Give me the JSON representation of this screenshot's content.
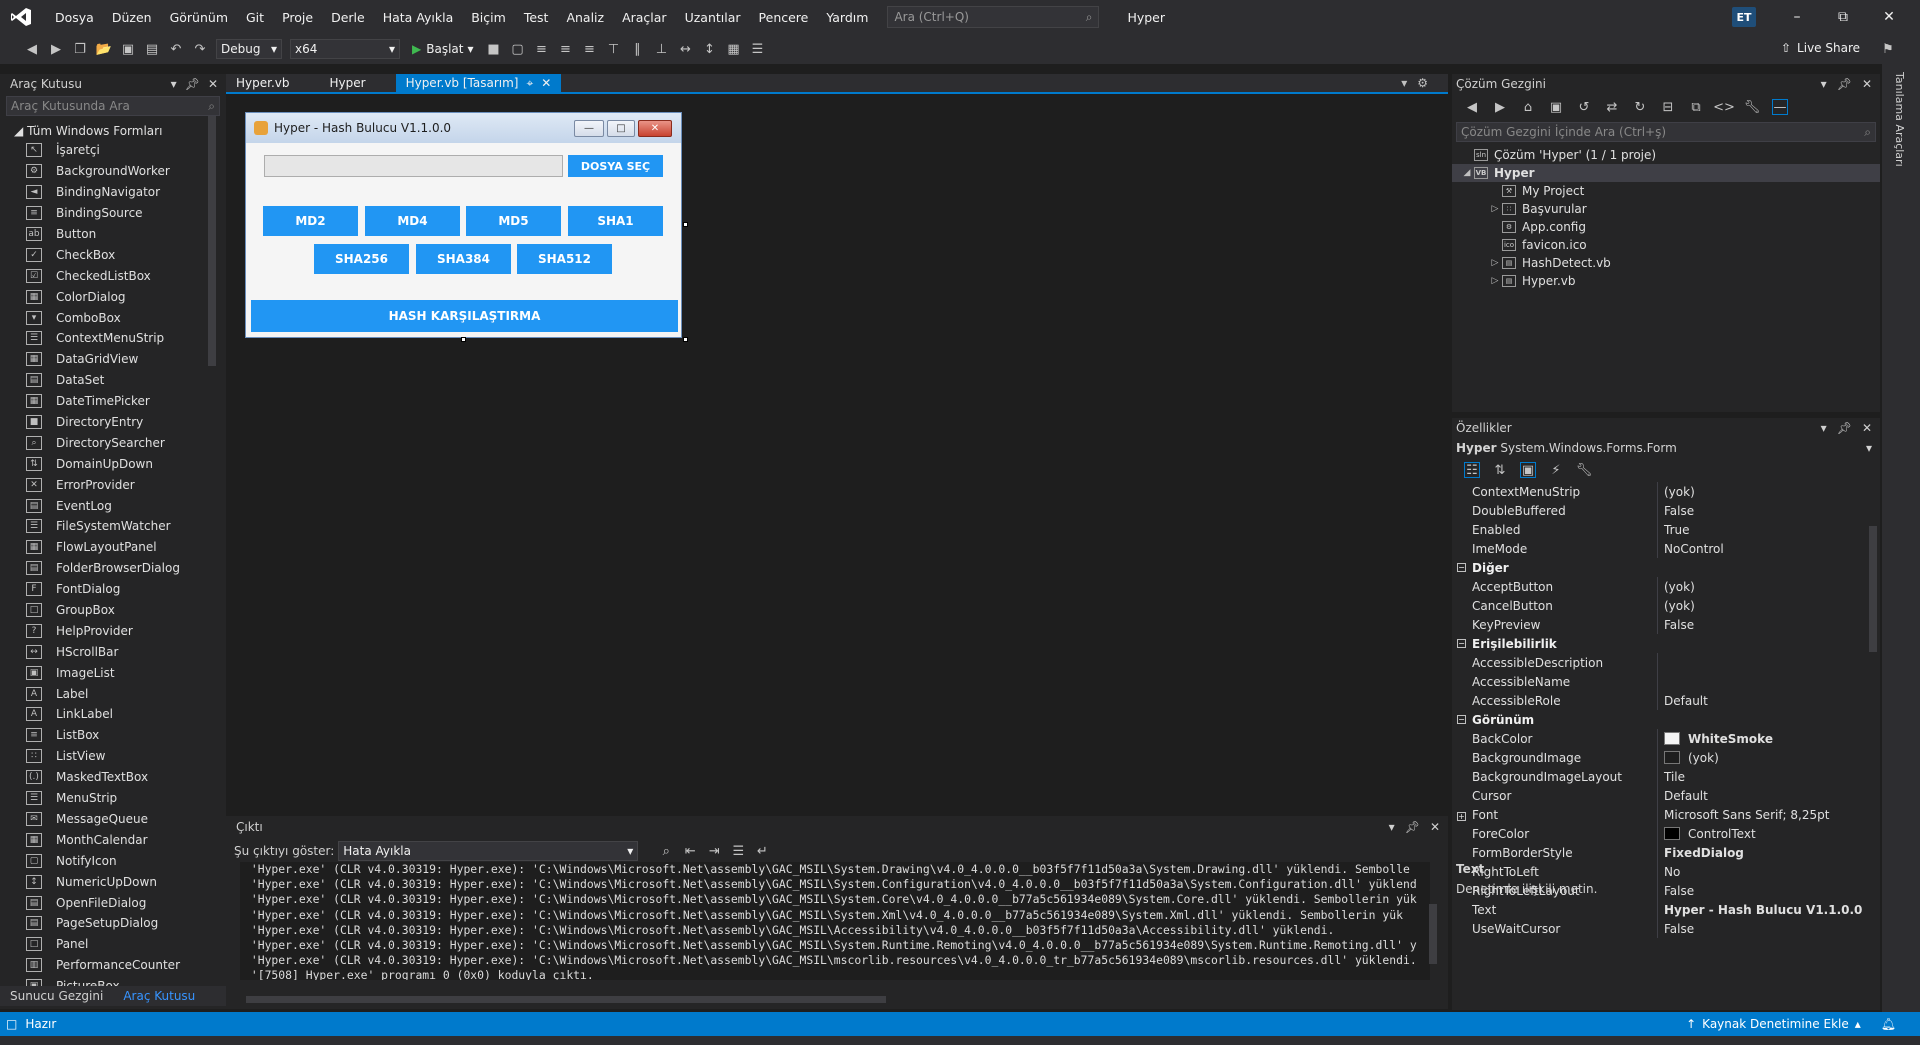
{
  "menu": {
    "items": [
      "Dosya",
      "Düzen",
      "Görünüm",
      "Git",
      "Proje",
      "Derle",
      "Hata Ayıkla",
      "Biçim",
      "Test",
      "Analiz",
      "Araçlar",
      "Uzantılar",
      "Pencere",
      "Yardım"
    ],
    "search_placeholder": "Ara (Ctrl+Q)",
    "solution_name": "Hyper",
    "user_initials": "ET"
  },
  "toolbar": {
    "config": "Debug",
    "platform": "x64",
    "start_label": "Başlat",
    "live_share": "Live Share"
  },
  "toolbox": {
    "title": "Araç Kutusu",
    "search_placeholder": "Araç Kutusunda Ara",
    "group": "Tüm Windows Formları",
    "items": [
      "İşaretçi",
      "BackgroundWorker",
      "BindingNavigator",
      "BindingSource",
      "Button",
      "CheckBox",
      "CheckedListBox",
      "ColorDialog",
      "ComboBox",
      "ContextMenuStrip",
      "DataGridView",
      "DataSet",
      "DateTimePicker",
      "DirectoryEntry",
      "DirectorySearcher",
      "DomainUpDown",
      "ErrorProvider",
      "EventLog",
      "FileSystemWatcher",
      "FlowLayoutPanel",
      "FolderBrowserDialog",
      "FontDialog",
      "GroupBox",
      "HelpProvider",
      "HScrollBar",
      "ImageList",
      "Label",
      "LinkLabel",
      "ListBox",
      "ListView",
      "MaskedTextBox",
      "MenuStrip",
      "MessageQueue",
      "MonthCalendar",
      "NotifyIcon",
      "NumericUpDown",
      "OpenFileDialog",
      "PageSetupDialog",
      "Panel",
      "PerformanceCounter",
      "PictureBox"
    ],
    "bottom_tabs": [
      "Sunucu Gezgini",
      "Araç Kutusu"
    ]
  },
  "doc_tabs": [
    "Hyper.vb",
    "Hyper",
    "Hyper.vb [Tasarım]"
  ],
  "form": {
    "title": "Hyper - Hash Bulucu V1.1.0.0",
    "select_file": "DOSYA SEÇ",
    "row1": [
      "MD2",
      "MD4",
      "MD5",
      "SHA1"
    ],
    "row2": [
      "SHA256",
      "SHA384",
      "SHA512"
    ],
    "compare": "HASH KARŞILAŞTIRMA",
    "button_color": "#2196f3"
  },
  "output": {
    "title": "Çıktı",
    "show_label": "Şu çıktıyı göster:",
    "source": "Hata Ayıkla",
    "lines": [
      " 'Hyper.exe' (CLR v4.0.30319: Hyper.exe): 'C:\\Windows\\Microsoft.Net\\assembly\\GAC_MSIL\\System.Drawing\\v4.0_4.0.0.0__b03f5f7f11d50a3a\\System.Drawing.dll' yüklendi. Sembolle",
      " 'Hyper.exe' (CLR v4.0.30319: Hyper.exe): 'C:\\Windows\\Microsoft.Net\\assembly\\GAC_MSIL\\System.Configuration\\v4.0_4.0.0.0__b03f5f7f11d50a3a\\System.Configuration.dll' yüklend",
      " 'Hyper.exe' (CLR v4.0.30319: Hyper.exe): 'C:\\Windows\\Microsoft.Net\\assembly\\GAC_MSIL\\System.Core\\v4.0_4.0.0.0__b77a5c561934e089\\System.Core.dll' yüklendi. Sembollerin yük",
      " 'Hyper.exe' (CLR v4.0.30319: Hyper.exe): 'C:\\Windows\\Microsoft.Net\\assembly\\GAC_MSIL\\System.Xml\\v4.0_4.0.0.0__b77a5c561934e089\\System.Xml.dll' yüklendi. Sembollerin yük",
      " 'Hyper.exe' (CLR v4.0.30319: Hyper.exe): 'C:\\Windows\\Microsoft.Net\\assembly\\GAC_MSIL\\Accessibility\\v4.0_4.0.0.0__b03f5f7f11d50a3a\\Accessibility.dll' yüklendi.",
      " 'Hyper.exe' (CLR v4.0.30319: Hyper.exe): 'C:\\Windows\\Microsoft.Net\\assembly\\GAC_MSIL\\System.Runtime.Remoting\\v4.0_4.0.0.0__b77a5c561934e089\\System.Runtime.Remoting.dll' y",
      " 'Hyper.exe' (CLR v4.0.30319: Hyper.exe): 'C:\\Windows\\Microsoft.Net\\assembly\\GAC_MSIL\\mscorlib.resources\\v4.0_4.0.0.0_tr_b77a5c561934e089\\mscorlib.resources.dll' yüklendi.",
      " '[7508] Hyper.exe' programı 0 (0x0) koduyla çıktı."
    ]
  },
  "solution_explorer": {
    "title": "Çözüm Gezgini",
    "search_placeholder": "Çözüm Gezgini İçinde Ara (Ctrl+ş)",
    "solution_label": "Çözüm 'Hyper' (1 / 1 proje)",
    "project": "Hyper",
    "children": [
      "My Project",
      "Başvurular",
      "App.config",
      "favicon.ico",
      "HashDetect.vb",
      "Hyper.vb"
    ]
  },
  "properties": {
    "title": "Özellikler",
    "object": "Hyper",
    "object_type": "System.Windows.Forms.Form",
    "rows_top": [
      [
        "ContextMenuStrip",
        "(yok)"
      ],
      [
        "DoubleBuffered",
        "False"
      ],
      [
        "Enabled",
        "True"
      ],
      [
        "ImeMode",
        "NoControl"
      ]
    ],
    "cat_other": "Diğer",
    "rows_other": [
      [
        "AcceptButton",
        "(yok)"
      ],
      [
        "CancelButton",
        "(yok)"
      ],
      [
        "KeyPreview",
        "False"
      ]
    ],
    "cat_access": "Erişilebilirlik",
    "rows_access": [
      [
        "AccessibleDescription",
        ""
      ],
      [
        "AccessibleName",
        ""
      ],
      [
        "AccessibleRole",
        "Default"
      ]
    ],
    "cat_view": "Görünüm",
    "backcolor_name": "BackColor",
    "backcolor_value": "WhiteSmoke",
    "bgimage_name": "BackgroundImage",
    "bgimage_value": "(yok)",
    "rows_view": [
      [
        "BackgroundImageLayout",
        "Tile"
      ],
      [
        "Cursor",
        "Default"
      ]
    ],
    "font_name": "Font",
    "font_value": "Microsoft Sans Serif; 8,25pt",
    "forecolor_name": "ForeColor",
    "forecolor_value": "ControlText",
    "rows_view2": [
      [
        "FormBorderStyle",
        "FixedDialog"
      ],
      [
        "RightToLeft",
        "No"
      ],
      [
        "RightToLeftLayout",
        "False"
      ],
      [
        "Text",
        "Hyper - Hash Bulucu V1.1.0.0"
      ],
      [
        "UseWaitCursor",
        "False"
      ]
    ],
    "desc_title": "Text",
    "desc_text": "Denetimle ilişkili metin."
  },
  "right_strip": "Tanılama Araçları",
  "status": {
    "text": "Hazır",
    "source_control": "Kaynak Denetimine Ekle"
  }
}
